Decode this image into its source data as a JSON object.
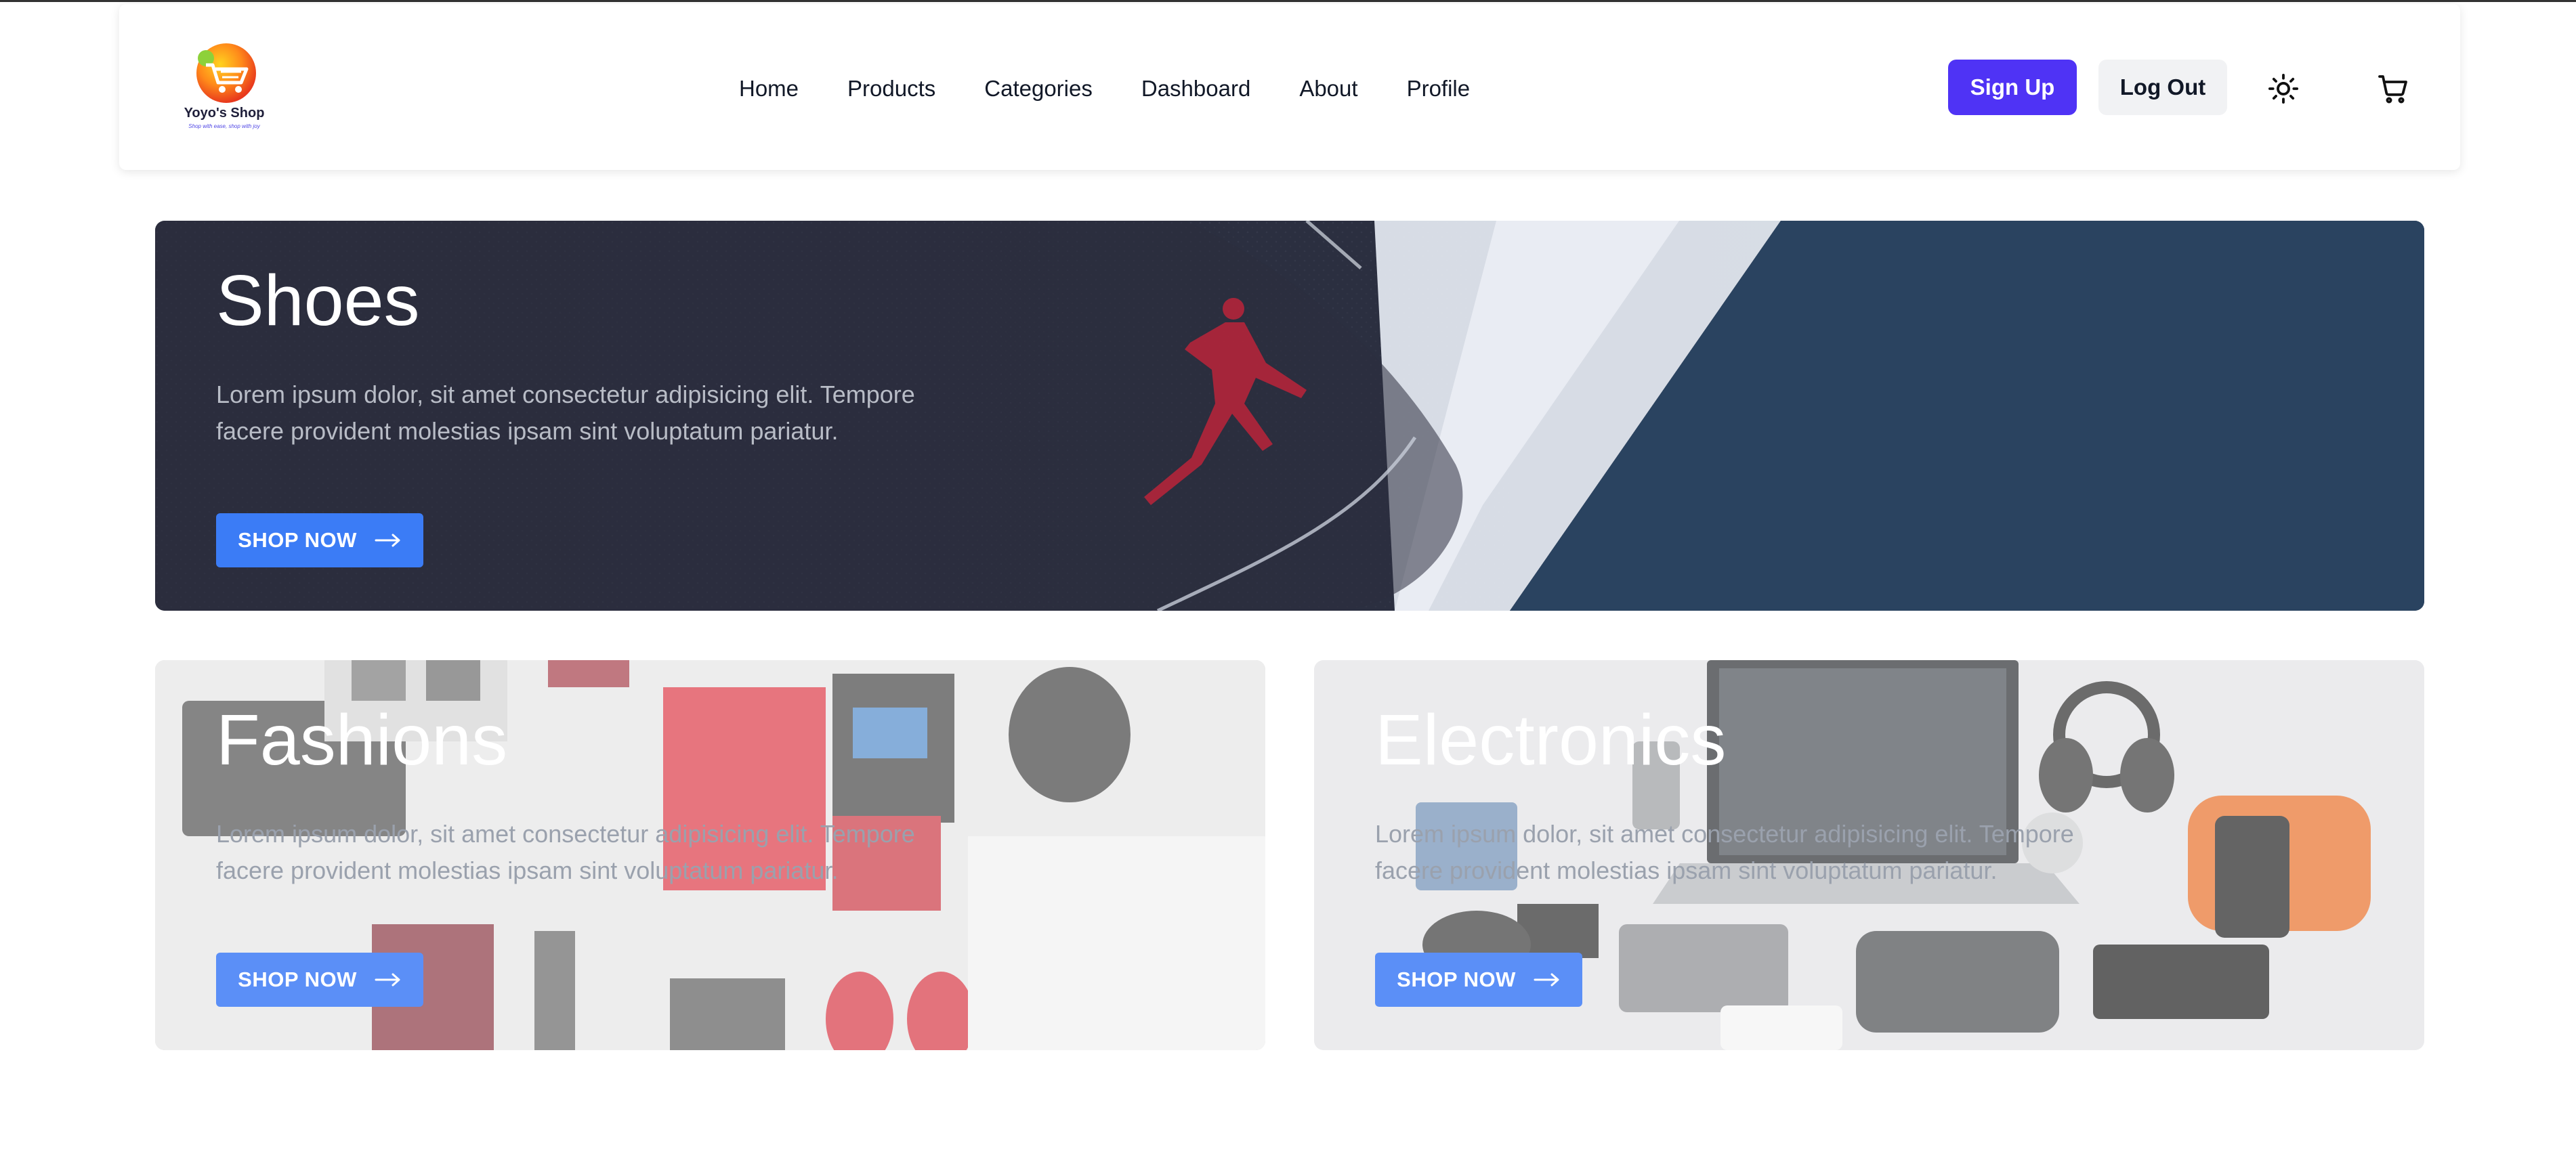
{
  "header": {
    "logo": {
      "name": "Yoyo's Shop",
      "tagline": "Shop with ease, shop with joy"
    },
    "nav": [
      "Home",
      "Products",
      "Categories",
      "Dashboard",
      "About",
      "Profile"
    ],
    "sign_up_label": "Sign Up",
    "log_out_label": "Log Out",
    "theme_icon": "sun-icon",
    "cart_icon": "cart-icon"
  },
  "banners": [
    {
      "title": "Shoes",
      "description": "Lorem ipsum dolor, sit amet consectetur adipisicing elit. Tempore facere provident molestias ipsam sint voluptatum pariatur.",
      "button_label": "SHOP NOW"
    },
    {
      "title": "Fashions",
      "description": "Lorem ipsum dolor, sit amet consectetur adipisicing elit. Tempore facere provident molestias ipsam sint voluptatum pariatur.",
      "button_label": "SHOP NOW"
    },
    {
      "title": "Electronics",
      "description": "Lorem ipsum dolor, sit amet consectetur adipisicing elit. Tempore facere provident molestias ipsam sint voluptatum pariatur.",
      "button_label": "SHOP NOW"
    }
  ],
  "colors": {
    "brand": "#4f33f5",
    "shop_button": "#3b7cf6"
  }
}
